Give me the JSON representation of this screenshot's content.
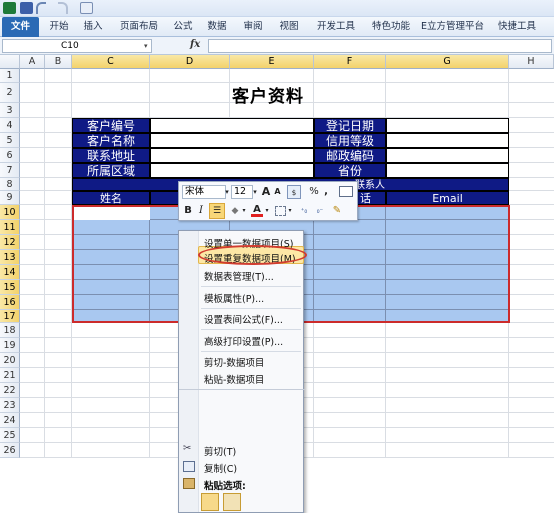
{
  "ribbon": {
    "file_tab": "文件",
    "tabs": [
      "开始",
      "插入",
      "页面布局",
      "公式",
      "数据",
      "审阅",
      "视图",
      "开发工具",
      "特色功能",
      "E立方管理平台",
      "快捷工具"
    ]
  },
  "formula_bar": {
    "name_box": "C10",
    "fx_label": "fx",
    "formula": ""
  },
  "columns": [
    "A",
    "B",
    "C",
    "D",
    "E",
    "F",
    "G",
    "H"
  ],
  "rows": [
    "1",
    "2",
    "3",
    "4",
    "5",
    "6",
    "7",
    "8",
    "9",
    "10",
    "11",
    "12",
    "13",
    "14",
    "15",
    "16",
    "17",
    "18",
    "19",
    "20",
    "21",
    "22",
    "23",
    "24",
    "25",
    "26"
  ],
  "sheet": {
    "title": "客户资料",
    "labels_left": [
      "客户编号",
      "客户名称",
      "联系地址",
      "所属区域"
    ],
    "labels_right": [
      "登记日期",
      "信用等级",
      "邮政编码",
      "省份"
    ],
    "row8_partial": "联系人",
    "header_row": {
      "name": "姓名",
      "phone_partial": "话",
      "email": "Email"
    }
  },
  "mini_toolbar": {
    "font_name": "宋体",
    "font_size": "12",
    "grow_font": "A",
    "shrink_font": "A",
    "percent": "%",
    "comma": ",",
    "bold": "B",
    "italic": "I",
    "font_color": "A"
  },
  "context_menu": {
    "items_top": [
      "设置单一数据项目(S)",
      "设置重复数据项目(M)",
      "数据表管理(T)...",
      "模板属性(P)...",
      "设置表间公式(F)...",
      "高级打印设置(P)...",
      "剪切-数据项目",
      "粘贴-数据项目"
    ],
    "cut": "剪切(T)",
    "copy": "复制(C)",
    "paste_options": "粘贴选项:"
  },
  "colors": {
    "label_bg": "#0f1a85",
    "selection_fill": "#a9c8f0",
    "selection_outline": "#cc2b2b",
    "highlight": "#fde7a5",
    "file_tab": "#2a6ab5"
  }
}
